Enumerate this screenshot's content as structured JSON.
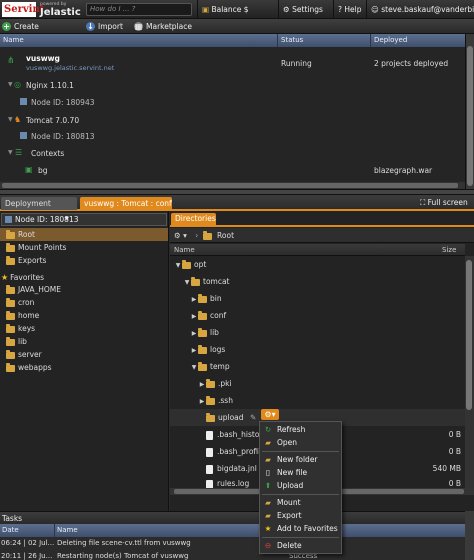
{
  "topbar": {
    "brand": "Servint",
    "powered_by": "powered by",
    "brand_sub": "Jelastic",
    "search_placeholder": "How do I ... ?",
    "balance_label": "Balance $",
    "settings_label": "Settings",
    "help_label": "Help",
    "user_label": "steve.baskauf@vanderbilt..."
  },
  "toolbar": {
    "create_env": "Create environment",
    "import": "Import",
    "marketplace": "Marketplace"
  },
  "env_grid": {
    "columns": [
      "Name",
      "Status",
      "Deployed"
    ],
    "env_name": "vuswwg",
    "env_domain": "vuswwg.jelastic.servint.net",
    "env_status": "Running",
    "env_deployed": "2 projects deployed",
    "nginx": "Nginx 1.10.1",
    "nginx_node": "Node ID: 180943",
    "tomcat": "Tomcat 7.0.70",
    "tomcat_node": "Node ID: 180813",
    "contexts": "Contexts",
    "bg": "bg",
    "bg_deployed": "blazegraph.war"
  },
  "tabs": {
    "deployment_manager": "Deployment manager",
    "config_tab": "vuswwg : Tomcat : config",
    "full_screen": "Full screen"
  },
  "left_panel": {
    "node_select": "Node ID: 180813",
    "root_items": [
      "Root",
      "Mount Points",
      "Exports"
    ],
    "favorites_label": "Favorites",
    "favorites": [
      "JAVA_HOME",
      "cron",
      "home",
      "keys",
      "lib",
      "server",
      "webapps"
    ]
  },
  "right_panel": {
    "directories_tab": "Directories",
    "path_root": "Root",
    "col_name": "Name",
    "col_size": "Size",
    "rows": [
      {
        "name": "opt",
        "size": ""
      },
      {
        "name": "tomcat",
        "size": ""
      },
      {
        "name": "bin",
        "size": ""
      },
      {
        "name": "conf",
        "size": ""
      },
      {
        "name": "lib",
        "size": ""
      },
      {
        "name": "logs",
        "size": ""
      },
      {
        "name": "temp",
        "size": ""
      },
      {
        "name": ".pki",
        "size": ""
      },
      {
        "name": ".ssh",
        "size": ""
      },
      {
        "name": "upload",
        "size": ""
      },
      {
        "name": ".bash_history",
        "size": "0 B"
      },
      {
        "name": ".bash_profile",
        "size": "0 B"
      },
      {
        "name": "bigdata.jnl",
        "size": "540 MB"
      },
      {
        "name": "rules.log",
        "size": "0 B"
      }
    ]
  },
  "context_menu": {
    "items": [
      "Refresh",
      "Open",
      "New folder",
      "New file",
      "Upload",
      "Mount",
      "Export",
      "Add to Favorites",
      "Delete"
    ]
  },
  "tasks": {
    "title": "Tasks",
    "columns": [
      "Date",
      "Name"
    ],
    "rows": [
      {
        "date": "06:24 | 02 Jul...",
        "name": "Deleting file scene-cv.ttl from vuswwg",
        "status": ""
      },
      {
        "date": "20:11 | 26 Ju...",
        "name": "Restarting node(s) Tomcat of vuswwg",
        "status": "Success"
      }
    ]
  },
  "colors": {
    "accent": "#e08a1e",
    "header_blue": "#4a5b7a",
    "running_green": "#3fa34d"
  }
}
